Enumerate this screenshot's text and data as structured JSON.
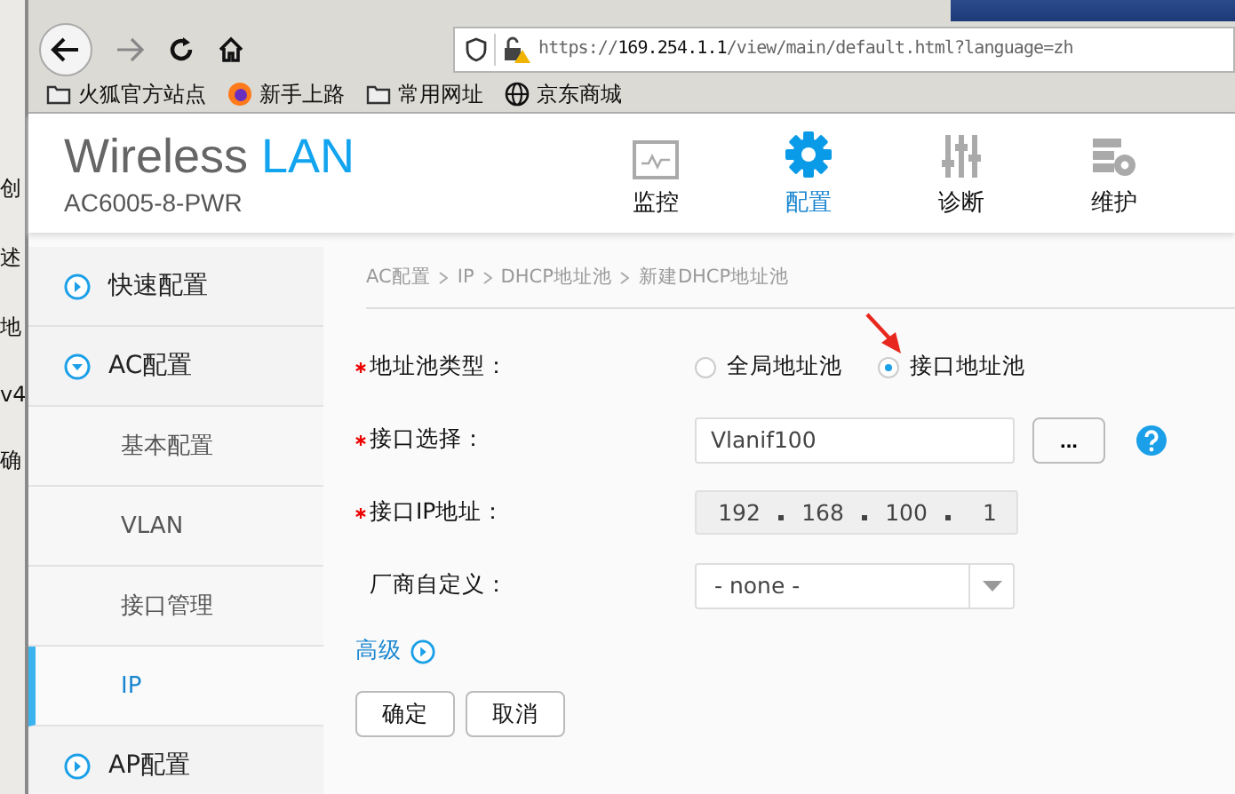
{
  "background_window": {
    "fragments": [
      "创",
      "述",
      "地",
      "v4",
      "确"
    ]
  },
  "browser": {
    "url_scheme": "https://",
    "url_host": "169.254.1.1",
    "url_path": "/view/main/default.html?language=zh",
    "bookmarks": [
      {
        "label": "火狐官方站点",
        "kind": "folder"
      },
      {
        "label": "新手上路",
        "kind": "firefox"
      },
      {
        "label": "常用网址",
        "kind": "folder"
      },
      {
        "label": "京东商城",
        "kind": "globe"
      }
    ]
  },
  "header": {
    "brand": "Wireless",
    "brand_highlight": "LAN",
    "model": "AC6005-8-PWR",
    "nav": [
      {
        "label": "监控",
        "selected": false
      },
      {
        "label": "配置",
        "selected": true
      },
      {
        "label": "诊断",
        "selected": false
      },
      {
        "label": "维护",
        "selected": false
      }
    ]
  },
  "sidebar": {
    "items": [
      {
        "label": "快速配置",
        "expanded": false
      },
      {
        "label": "AC配置",
        "expanded": true,
        "children": [
          {
            "label": "基本配置",
            "selected": false
          },
          {
            "label": "VLAN",
            "selected": false
          },
          {
            "label": "接口管理",
            "selected": false
          },
          {
            "label": "IP",
            "selected": true
          }
        ]
      },
      {
        "label": "AP配置",
        "expanded": false
      }
    ]
  },
  "breadcrumb": [
    "AC配置",
    "IP",
    "DHCP地址池",
    "新建DHCP地址池"
  ],
  "form": {
    "fields": [
      {
        "kind": "radio",
        "label": "地址池类型：",
        "required": true,
        "options": [
          {
            "label": "全局地址池",
            "selected": false
          },
          {
            "label": "接口地址池",
            "selected": true
          }
        ]
      },
      {
        "kind": "picker",
        "label": "接口选择：",
        "required": true,
        "value": "Vlanif100",
        "button": "..."
      },
      {
        "kind": "ip",
        "label": "接口IP地址：",
        "required": true,
        "octets": [
          "192",
          "168",
          "100",
          "1"
        ]
      },
      {
        "kind": "select",
        "label": "厂商自定义：",
        "required": false,
        "value": "- none -"
      }
    ],
    "advanced": "高级",
    "buttons": [
      "确定",
      "取消"
    ]
  }
}
